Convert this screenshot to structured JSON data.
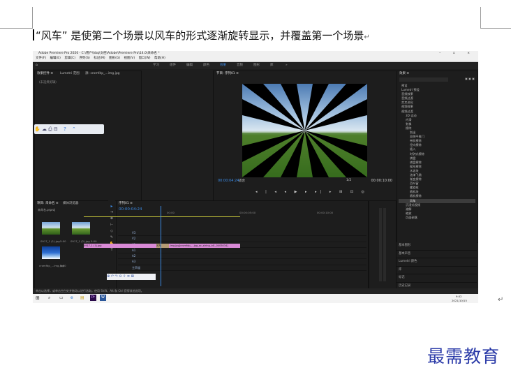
{
  "caption": {
    "text": "“风车” 是使第二个场景以风车的形式逐渐旋转显示，并覆盖第一个场景",
    "mark": "↵"
  },
  "window": {
    "title": "Adobe Premiere Pro 2020 - C:\\用户\\hbq\\文档\\Adobe\\Premiere Pro\\14.0\\未命名 *",
    "controls": "– ▫ ×"
  },
  "menu": [
    "文件(F)",
    "编辑(E)",
    "剪辑(C)",
    "序列(S)",
    "标记(M)",
    "图形(G)",
    "视图(V)",
    "窗口(W)",
    "帮助(H)"
  ],
  "workspaces": [
    "学习",
    "组件",
    "编辑",
    "颜色",
    "效果",
    "音频",
    "图形",
    "库",
    "»"
  ],
  "effect_controls": {
    "tabs": [
      "效果控件 ≡",
      "Lumetri 范围",
      "源: cromfdp_...img.jpg",
      "音频剪辑混合器: 序列01"
    ],
    "empty": "(未选择剪辑)"
  },
  "program": {
    "tab": "节目: 序列01 ≡",
    "timecode": "00:00:04:24",
    "fit": "适合",
    "full": "1/2",
    "duration": "00:00:10:00",
    "controls": "◂ | ◂ ◂ ▶ ▸ ▸| ▸ ⊞ ⊡ ◎"
  },
  "effects": {
    "tab": "效果 ≡",
    "items": [
      "预设",
      "Lumetri 预设",
      "音频效果",
      "音频过渡",
      "交叉淡化",
      "视频效果",
      "视频过渡",
      "3D 运动",
      "内滑",
      "划像",
      "擦除",
      "划出",
      "双侧平推门",
      "带状擦除",
      "径向擦除",
      "插入",
      "时钟式擦除",
      "棋盘",
      "棋盘擦除",
      "楔形擦除",
      "水波块",
      "油漆飞溅",
      "渐变擦除",
      "百叶窗",
      "螺旋框",
      "随机块",
      "随机擦除",
      "风车",
      "沉浸式视频",
      "溶解",
      "缩放",
      "页面剥落"
    ],
    "selected": "风车"
  },
  "right_panels": [
    "基本图形",
    "基本声音",
    "Lumetri 颜色",
    "库",
    "标记",
    "历史记录",
    "信息"
  ],
  "project": {
    "tabs": [
      "项目: 未命名 ≡",
      "媒体浏览器"
    ],
    "file": "未命名.prproj",
    "items": [
      {
        "name": "0917_1 (1).jpg",
        "dur": "5:00"
      },
      {
        "name": "0917_1 (2).jpg",
        "dur": "5:00"
      },
      {
        "name": "cromfdp_...img.jpg",
        "dur": "5:00"
      }
    ]
  },
  "timeline": {
    "tab": "序列01 ≡",
    "timecode": "00:00:04:24",
    "tracks": [
      "V3",
      "V2",
      "V1",
      "A1",
      "A2",
      "A3",
      "主声道"
    ],
    "clip1": "0917_1 (1).jpg",
    "clip2": "cromfdp_...img.jpg[cromfdp_...jpg_ac_string_id1_0405034]",
    "transition": "风车",
    "ruler": [
      "00:00",
      "00:00:05:00",
      "00:00:10:00"
    ]
  },
  "status": "单击以选择，或单击空白处并拖动以进行选取。使用 Shift、Alt 和 Ctrl 获得其他选项。",
  "taskbar": {
    "time": "9:02",
    "date": "2021/10/15"
  },
  "watermark": "最需教育",
  "colors": {
    "accent": "#3c8be6",
    "clip": "#d98ad6",
    "transition": "#b59b74",
    "watermark": "#2a3aa8"
  }
}
